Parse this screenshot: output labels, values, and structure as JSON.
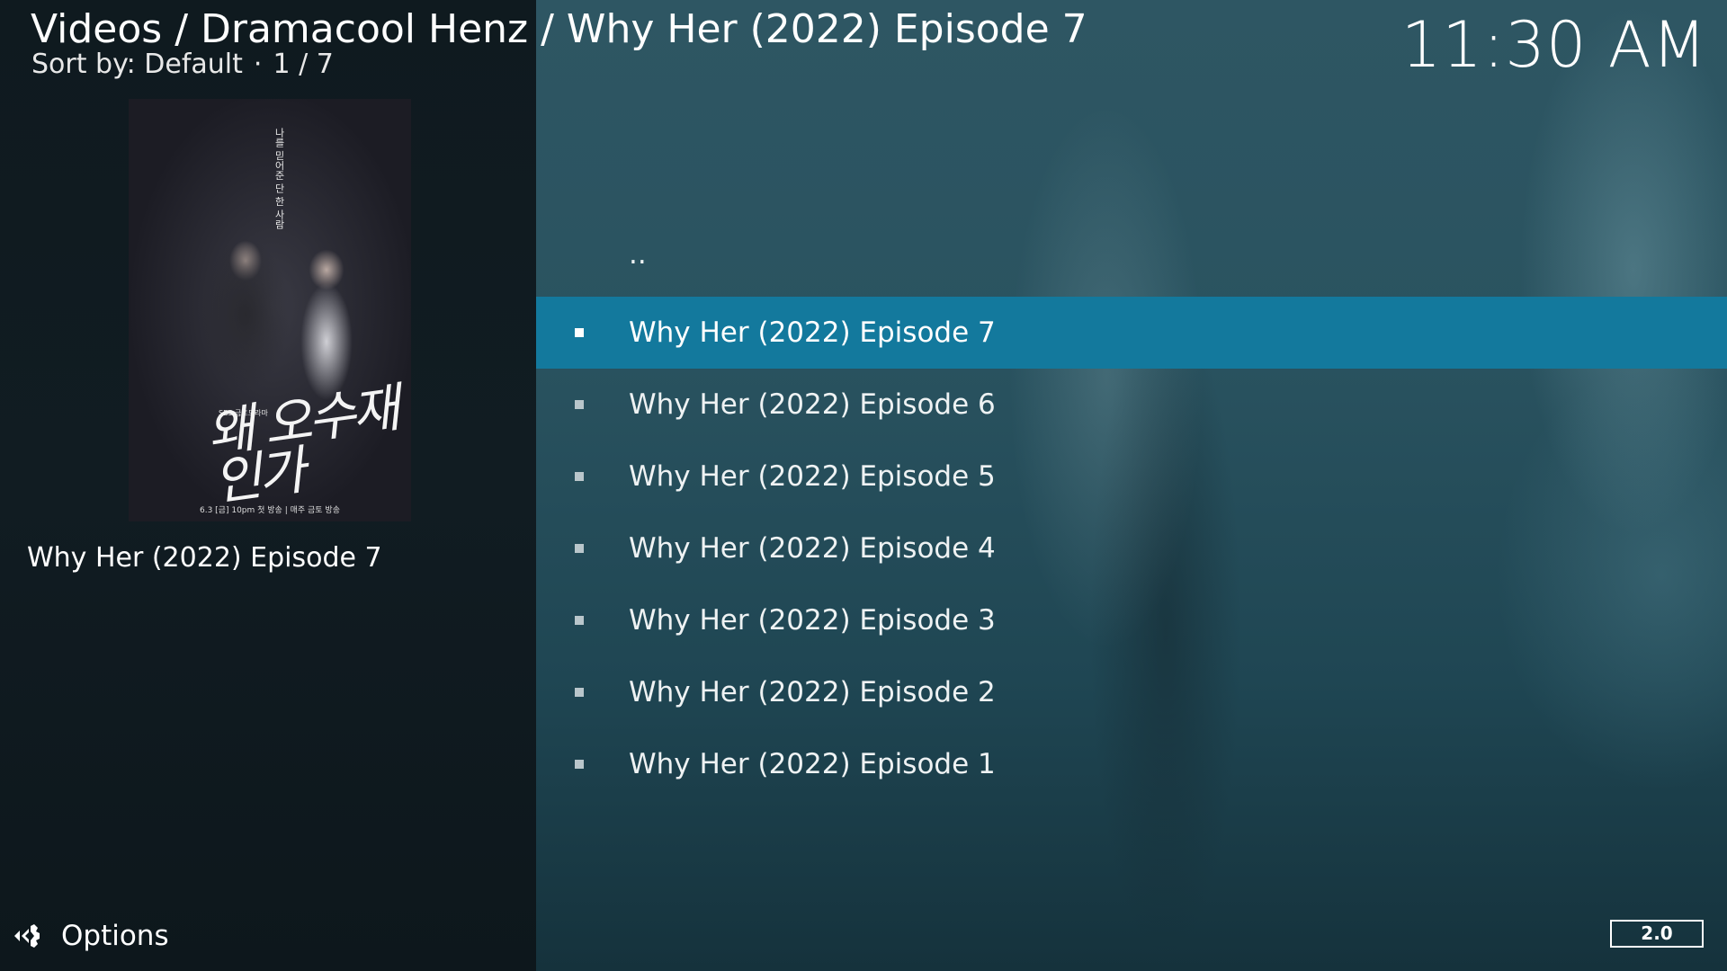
{
  "header": {
    "path": "Videos / Dramacool Henz / Why Her (2022) Episode 7",
    "sort_label": "Sort by: Default",
    "separator": "·",
    "position": "1 / 7"
  },
  "clock": "11:30 AM",
  "poster": {
    "title": "왜 오수재 인가",
    "network": "SBS 금토드라마",
    "tagline": "나를 믿어준 단 한 사람",
    "credit": "6.3 [금] 10pm 첫 방송 | 매주 금토 방송"
  },
  "selected_title": "Why Her (2022) Episode 7",
  "list": {
    "parent": "..",
    "items": [
      {
        "label": "Why Her (2022) Episode 7",
        "focused": true
      },
      {
        "label": "Why Her (2022) Episode 6",
        "focused": false
      },
      {
        "label": "Why Her (2022) Episode 5",
        "focused": false
      },
      {
        "label": "Why Her (2022) Episode 4",
        "focused": false
      },
      {
        "label": "Why Her (2022) Episode 3",
        "focused": false
      },
      {
        "label": "Why Her (2022) Episode 2",
        "focused": false
      },
      {
        "label": "Why Her (2022) Episode 1",
        "focused": false
      }
    ]
  },
  "footer": {
    "options_label": "Options",
    "options_icon": "options-icon",
    "version": "2.0"
  },
  "colors": {
    "focus": "#13799d",
    "panel": "#111c22",
    "text": "#ffffff"
  }
}
